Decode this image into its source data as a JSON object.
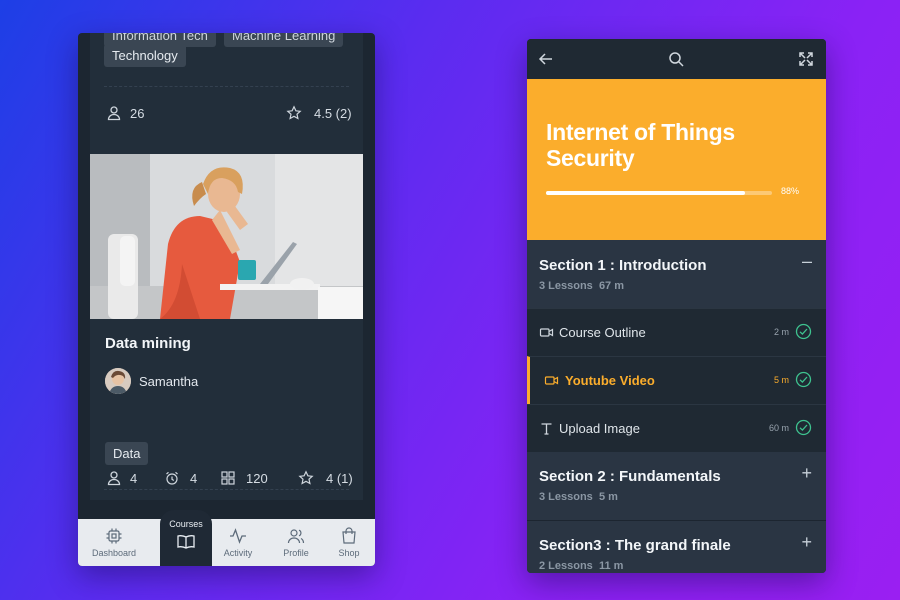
{
  "left_app": {
    "top_card": {
      "tags_partial": [
        "Information Tech",
        "Machine Learning"
      ],
      "tag": "Technology",
      "students": "26",
      "rating": "4.5 (2)"
    },
    "course_card": {
      "title": "Data mining",
      "author": "Samantha",
      "tag": "Data",
      "students": "4",
      "duration": "4",
      "lessons": "120",
      "rating": "4 (1)"
    },
    "nav": {
      "dashboard": "Dashboard",
      "courses": "Courses",
      "activity": "Activity",
      "profile": "Profile",
      "shop": "Shop"
    }
  },
  "right_app": {
    "course_title": "Internet of Things Security",
    "progress_value": 88,
    "progress_label": "88%",
    "sections": [
      {
        "title": "Section 1 : Introduction",
        "meta_lessons": "3 Lessons",
        "meta_time": "67 m",
        "control": "–",
        "lessons": [
          {
            "name": "Course Outline",
            "duration": "2 m",
            "icon": "video-icon"
          },
          {
            "name": "Youtube Video",
            "duration": "5 m",
            "icon": "video-icon"
          },
          {
            "name": "Upload Image",
            "duration": "60 m",
            "icon": "text-icon"
          }
        ]
      },
      {
        "title": "Section 2 : Fundamentals",
        "meta_lessons": "3 Lessons",
        "meta_time": "5 m",
        "control": "+"
      },
      {
        "title": "Section3 : The grand finale",
        "meta_lessons": "2 Lessons",
        "meta_time": "11 m",
        "control": "+"
      }
    ]
  },
  "colors": {
    "accent": "#fbad2c",
    "panel": "#1f2933",
    "section": "#2a3543",
    "check": "#3ec28f"
  }
}
